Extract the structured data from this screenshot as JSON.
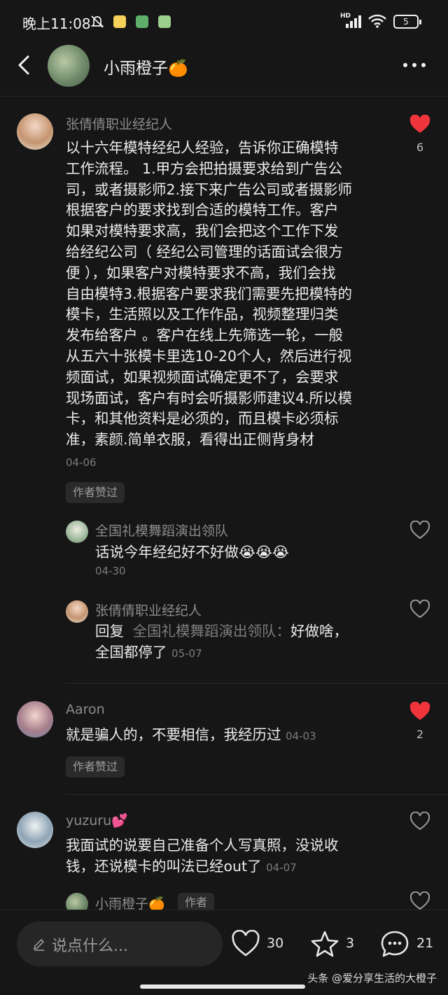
{
  "status_bar": {
    "time": "晚上11:08",
    "network": "HD",
    "battery": "5"
  },
  "header": {
    "title": "小雨橙子🍊",
    "icons": [
      "back-arrow",
      "avatar",
      "more-dots"
    ]
  },
  "comments": [
    {
      "user": "张倩倩职业经纪人",
      "lines": [
        "以十六年模特经纪人经验，告诉你正确模特",
        "工作流程。 1.甲方会把拍摄要求给到广告公",
        "司，或者摄影师2.接下来广告公司或者摄影师",
        "根据客户的要求找到合适的模特工作。客户",
        "如果对模特要求高，我们会把这个工作下发",
        "给经纪公司（ 经纪公司管理的话面试会很方",
        "便 ），如果客户对模特要求不高，我们会找",
        "自由模特3.根据客户要求我们需要先把模特的",
        "模卡，生活照以及工作作品，视频整理归类",
        "发布给客户 。客户在线上先筛选一轮，一般",
        "从五六十张模卡里选10-20个人，然后进行视",
        "频面试，如果视频面试确定更不了，会要求",
        "现场面试，客户有时会听摄影师建议4.所以模",
        "卡，和其他资料是必须的，而且模卡必须标",
        "准，素颜.简单衣服，看得出正侧背身材"
      ],
      "date": "04-06",
      "tag": "作者赞过",
      "likes": "6",
      "liked": true,
      "replies": [
        {
          "user": "全国礼模舞蹈演出领队",
          "text": "话说今年经纪好不好做😭😭😭",
          "date": "04-30"
        },
        {
          "user": "张倩倩职业经纪人",
          "reply_prefix": "回复",
          "reply_target": "全国礼模舞蹈演出领队：",
          "line1_text": "好做啥，",
          "line2_text": "全国都停了",
          "date": "05-07"
        }
      ]
    },
    {
      "user": "Aaron",
      "text": "就是骗人的，不要相信，我经历过",
      "date": "04-03",
      "tag": "作者赞过",
      "likes": "2",
      "liked": true
    },
    {
      "user": "yuzuru💕",
      "line1": "我面试的说要自己准备个人写真照，没说收",
      "line2": "钱，还说模卡的叫法已经out了",
      "date": "04-07",
      "reply_preview": {
        "user": "小雨橙子🍊",
        "badge": "作者"
      }
    }
  ],
  "bottom_bar": {
    "placeholder": "说点什么...",
    "like_count": "30",
    "fav_count": "3",
    "comment_count": "21",
    "watermark": "头条 @爱分享生活的大橙子"
  },
  "colors": {
    "background": "#161616",
    "like_red": "#f0343c",
    "text_primary": "#ececec",
    "text_secondary": "#8c8c8c"
  }
}
